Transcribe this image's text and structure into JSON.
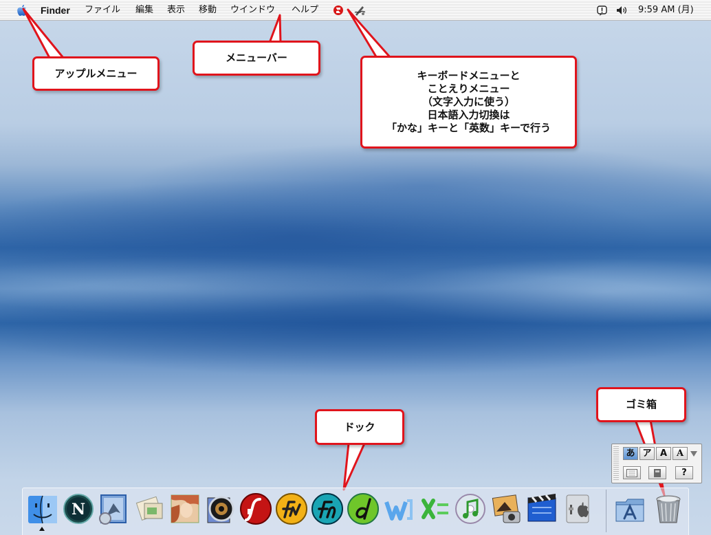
{
  "menubar": {
    "app_name": "Finder",
    "menus": [
      "ファイル",
      "編集",
      "表示",
      "移動",
      "ウインドウ",
      "ヘルプ"
    ],
    "clock": "9:59 AM (月)",
    "icons": [
      "apple-icon",
      "keyboard-menu-icon",
      "kotoeri-icon",
      "notification-icon",
      "volume-icon"
    ]
  },
  "callouts": {
    "apple_menu": "アップルメニュー",
    "menubar": "メニューバー",
    "keyboard_menu": [
      "キーボードメニューと",
      "ことえりメニュー",
      "（文字入力に使う）",
      "日本語入力切換は",
      "「かな」キーと「英数」キーで行う"
    ],
    "dock": "ドック",
    "trash": "ゴミ箱"
  },
  "palette": {
    "buttons": [
      "あ",
      "ア",
      "A",
      "A"
    ],
    "help": "?"
  },
  "dock": {
    "icons": [
      "finder-icon",
      "netscape-icon",
      "mail-icon",
      "preview-icon",
      "photoshop-icon",
      "iris-icon",
      "flash-icon",
      "fireworks-icon",
      "freehand-icon",
      "dreamweaver-icon",
      "word-icon",
      "excel-icon",
      "itunes-icon",
      "iphoto-icon",
      "imovie-icon",
      "system-prefs-icon",
      "applications-folder-icon",
      "trash-icon"
    ]
  },
  "colors": {
    "callout_border": "#e0141c",
    "desktop_blue": "#2f66a8"
  }
}
